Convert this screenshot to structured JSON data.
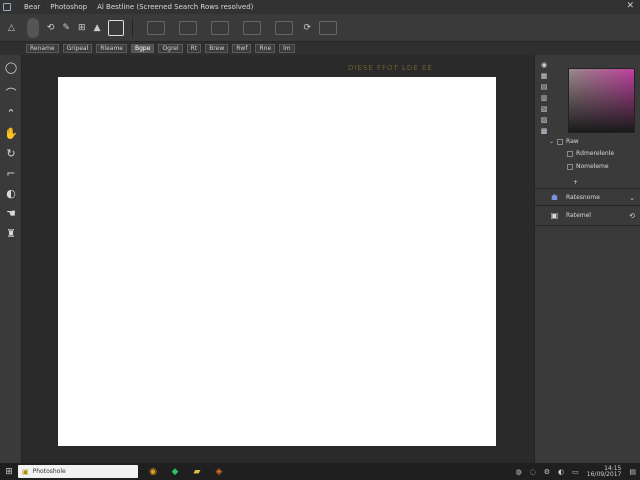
{
  "menubar": {
    "items": [
      "Bear",
      "Photoshop",
      "Al Bestline (Screened Search Rows resolved)"
    ]
  },
  "doc_tabs": [
    "Rename",
    "Gripeal",
    "Rleame",
    "Bgpe",
    "Ogrel",
    "Rt",
    "Brew",
    "Rwf",
    "Rne",
    "lm"
  ],
  "canvas_header_text": "DIESE FFOT LDE EE",
  "panel": {
    "layer_group_label": "Raw",
    "sub_items": [
      "Rdmerelenle",
      "Nomeleme"
    ],
    "layer_rows": [
      {
        "label": "Ratesnome"
      },
      {
        "label": "Ratemel"
      }
    ]
  },
  "taskbar": {
    "search_text": "Photoshole",
    "clock_time": "14:15",
    "clock_date": "16/09/2017"
  }
}
